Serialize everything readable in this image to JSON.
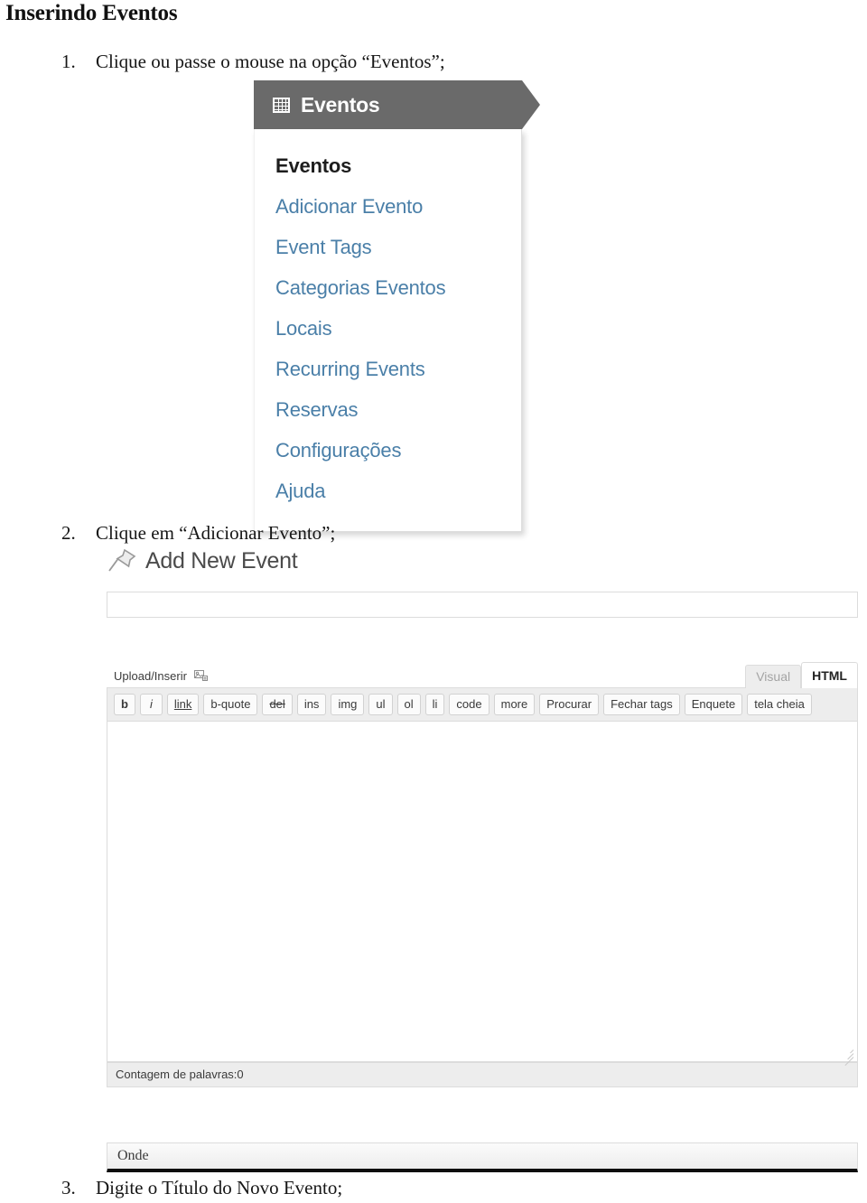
{
  "document": {
    "title": "Inserindo Eventos",
    "steps": [
      {
        "num": "1.",
        "text": "Clique ou passe o mouse  na opção “Eventos”;"
      },
      {
        "num": "2.",
        "text": "Clique em “Adicionar Evento”;"
      },
      {
        "num": "3.",
        "text": "Digite o Título do Novo Evento;"
      }
    ]
  },
  "wp_menu": {
    "header_label": "Eventos",
    "header_icon": "calendar-icon",
    "items": [
      {
        "label": "Eventos",
        "current": true
      },
      {
        "label": "Adicionar Evento",
        "current": false
      },
      {
        "label": "Event Tags",
        "current": false
      },
      {
        "label": "Categorias Eventos",
        "current": false
      },
      {
        "label": "Locais",
        "current": false
      },
      {
        "label": "Recurring Events",
        "current": false
      },
      {
        "label": "Reservas",
        "current": false
      },
      {
        "label": "Configurações",
        "current": false
      },
      {
        "label": "Ajuda",
        "current": false
      }
    ],
    "colors": {
      "header_bg": "#6a6a6a",
      "link": "#4a7fa8",
      "current": "#1d1d1d"
    }
  },
  "add_event_screen": {
    "heading": "Add New Event",
    "heading_icon": "pushpin-icon",
    "title_input_value": "",
    "title_input_placeholder": "",
    "editor": {
      "media_label": "Upload/Inserir",
      "media_icon": "insert-media-icon",
      "tabs": [
        {
          "label": "Visual",
          "active": false
        },
        {
          "label": "HTML",
          "active": true
        }
      ],
      "toolbar_buttons": [
        {
          "label": "b",
          "style": "bold"
        },
        {
          "label": "i",
          "style": "italic"
        },
        {
          "label": "link",
          "style": "under"
        },
        {
          "label": "b-quote",
          "style": ""
        },
        {
          "label": "del",
          "style": "strike"
        },
        {
          "label": "ins",
          "style": ""
        },
        {
          "label": "img",
          "style": ""
        },
        {
          "label": "ul",
          "style": ""
        },
        {
          "label": "ol",
          "style": ""
        },
        {
          "label": "li",
          "style": ""
        },
        {
          "label": "code",
          "style": ""
        },
        {
          "label": "more",
          "style": ""
        },
        {
          "label": "Procurar",
          "style": ""
        },
        {
          "label": "Fechar tags",
          "style": ""
        },
        {
          "label": "Enquete",
          "style": ""
        },
        {
          "label": "tela cheia",
          "style": ""
        }
      ],
      "content": "",
      "word_count": "Contagem de palavras:0",
      "resize_handle": "resize-grip-icon"
    },
    "onde_panel": {
      "label": "Onde"
    }
  }
}
